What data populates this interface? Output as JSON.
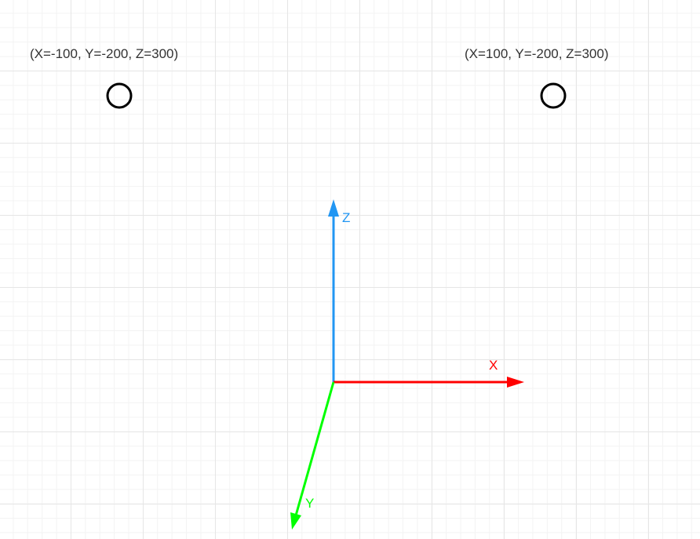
{
  "colors": {
    "x_axis": "#ff0000",
    "y_axis": "#00ff00",
    "z_axis": "#2196f3",
    "point_stroke": "#000000",
    "label_text": "#333333"
  },
  "axes": {
    "x_label": "X",
    "y_label": "Y",
    "z_label": "Z"
  },
  "points": [
    {
      "label": "(X=-100, Y=-200, Z=300)"
    },
    {
      "label": "(X=100, Y=-200, Z=300)"
    }
  ]
}
